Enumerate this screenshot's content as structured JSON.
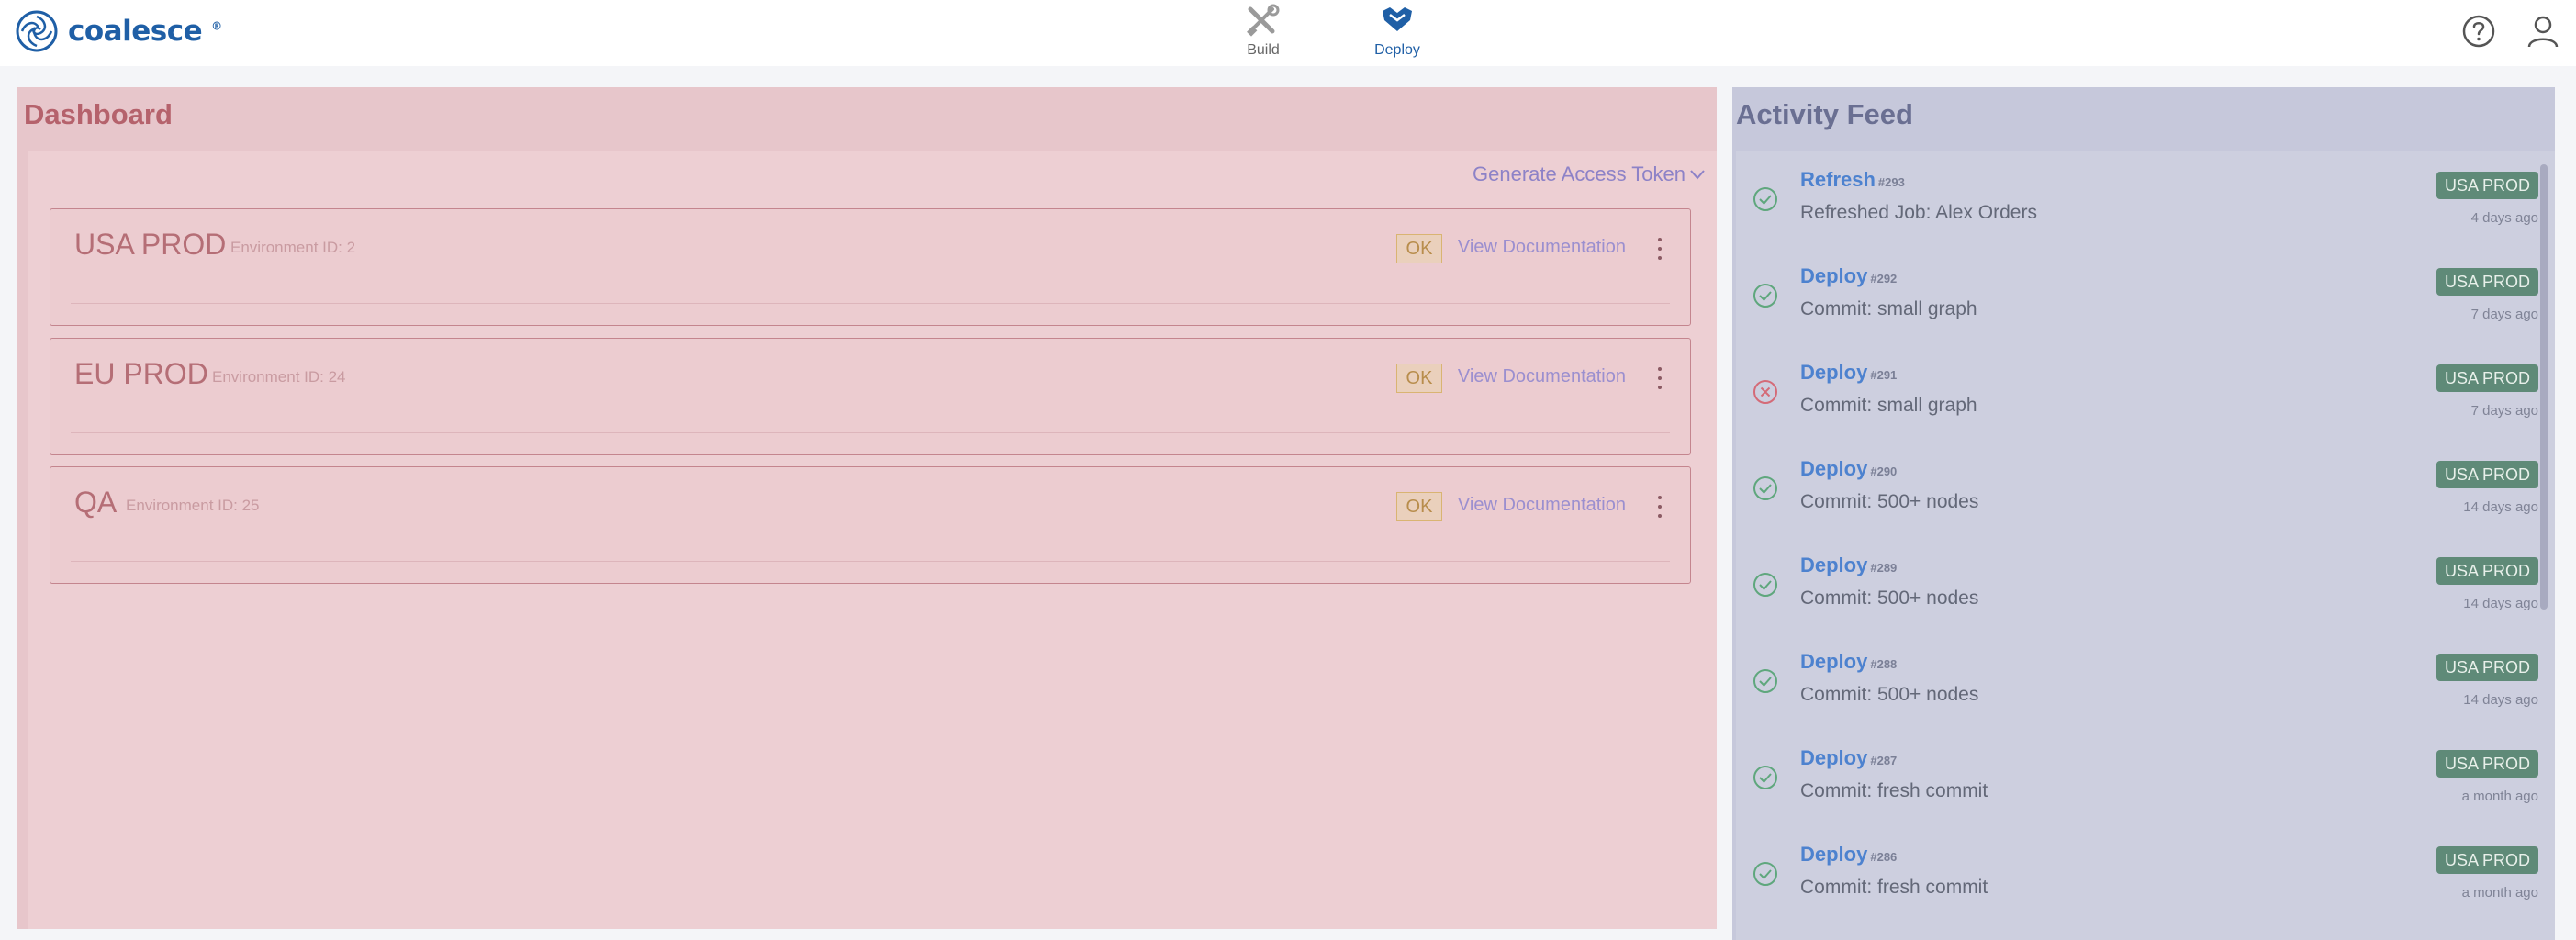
{
  "app": {
    "brand": "coalesce"
  },
  "nav": {
    "build_label": "Build",
    "deploy_label": "Deploy"
  },
  "dashboard": {
    "title": "Dashboard",
    "generate_token_label": "Generate Access Token",
    "environments": [
      {
        "name": "USA PROD",
        "env_id": "Environment ID: 2",
        "status": "OK",
        "doc_label": "View Documentation"
      },
      {
        "name": "EU PROD",
        "env_id": "Environment ID: 24",
        "status": "OK",
        "doc_label": "View Documentation"
      },
      {
        "name": "QA",
        "env_id": "Environment ID: 25",
        "status": "OK",
        "doc_label": "View Documentation"
      }
    ]
  },
  "activity": {
    "title": "Activity Feed",
    "items": [
      {
        "type": "Refresh",
        "number": "#293",
        "description": "Refreshed Job: Alex Orders",
        "env": "USA PROD",
        "time": "4 days ago",
        "status": "success"
      },
      {
        "type": "Deploy",
        "number": "#292",
        "description": "Commit: small graph",
        "env": "USA PROD",
        "time": "7 days ago",
        "status": "success"
      },
      {
        "type": "Deploy",
        "number": "#291",
        "description": "Commit: small graph",
        "env": "USA PROD",
        "time": "7 days ago",
        "status": "failed"
      },
      {
        "type": "Deploy",
        "number": "#290",
        "description": "Commit: 500+ nodes",
        "env": "USA PROD",
        "time": "14 days ago",
        "status": "success"
      },
      {
        "type": "Deploy",
        "number": "#289",
        "description": "Commit: 500+ nodes",
        "env": "USA PROD",
        "time": "14 days ago",
        "status": "success"
      },
      {
        "type": "Deploy",
        "number": "#288",
        "description": "Commit: 500+ nodes",
        "env": "USA PROD",
        "time": "14 days ago",
        "status": "success"
      },
      {
        "type": "Deploy",
        "number": "#287",
        "description": "Commit: fresh commit",
        "env": "USA PROD",
        "time": "a month ago",
        "status": "success"
      },
      {
        "type": "Deploy",
        "number": "#286",
        "description": "Commit: fresh commit",
        "env": "USA PROD",
        "time": "a month ago",
        "status": "success"
      }
    ]
  },
  "colors": {
    "brand": "#1f5fa6",
    "success": "#5fa77d",
    "failed": "#d46b78",
    "env_badge": "#5f8a78"
  }
}
